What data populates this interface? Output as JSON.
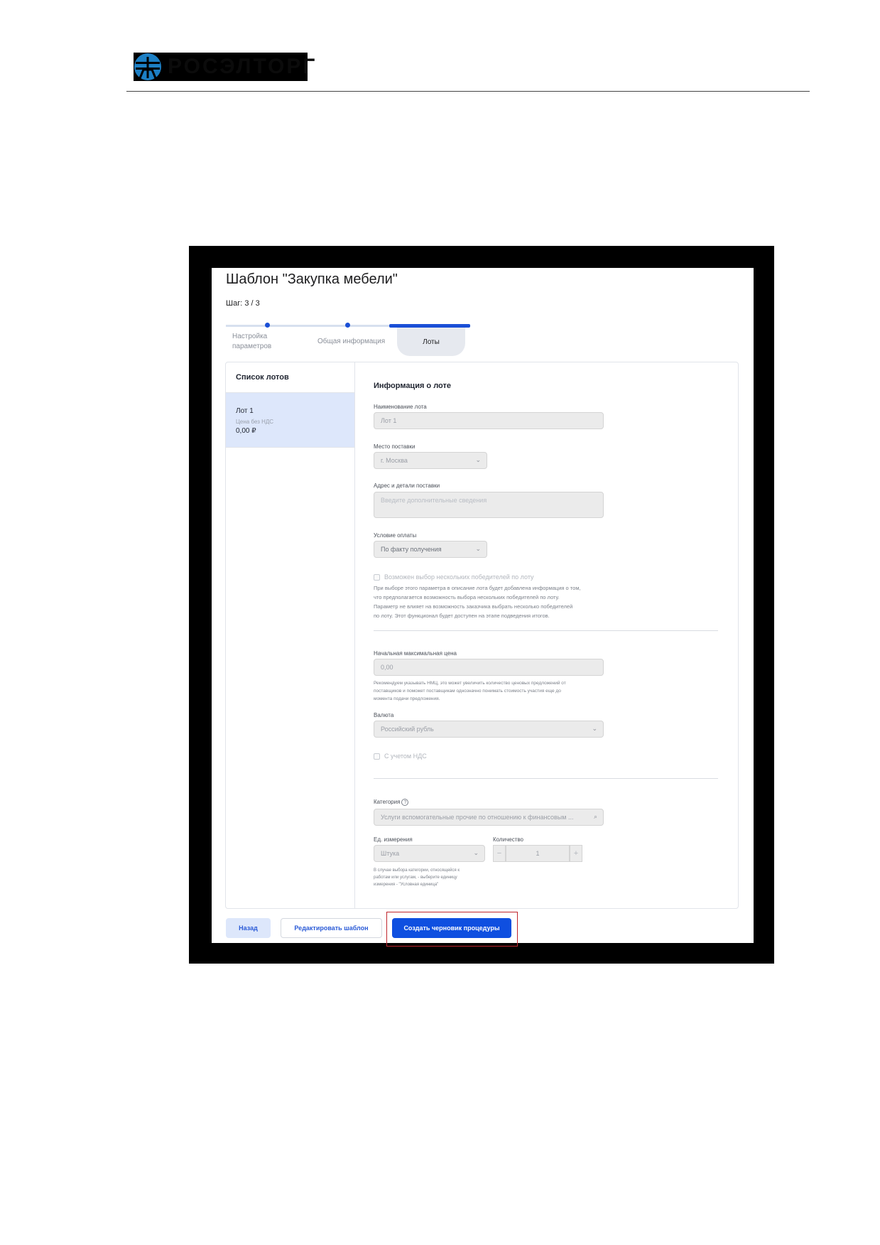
{
  "document": {
    "logo_text": "РОСЭЛТОРГ"
  },
  "page": {
    "title": "Шаблон \"Закупка мебели\"",
    "step": "Шаг: 3 / 3"
  },
  "stepper": {
    "steps": [
      {
        "line1": "Настройка",
        "line2": "параметров"
      },
      {
        "line1": "Общая информация"
      },
      {
        "line1": "Лоты"
      }
    ]
  },
  "lots": {
    "title": "Список лотов",
    "items": [
      {
        "name": "Лот 1",
        "price_label": "Цена без НДС",
        "price": "0,00 ₽"
      }
    ]
  },
  "form": {
    "section_title": "Информация о лоте",
    "lot_name_label": "Наименование лота",
    "lot_name_value": "Лот 1",
    "delivery_place_label": "Место поставки",
    "delivery_place_value": "г. Москва",
    "address_label": "Адрес и детали поставки",
    "address_placeholder": "Введите дополнительные сведения",
    "payment_label": "Условие оплаты",
    "payment_value": "По факту получения",
    "multi_winners_label": "Возможен выбор нескольких победителей по лоту",
    "multi_winners_note": [
      "При выборе этого параметра в описание лота будет добавлена информация о том,",
      "что предполагается возможность выбора нескольких победителей по лоту.",
      "Параметр не влияет на возможность заказчика выбрать несколько победителей",
      "по лоту. Этот функционал будет доступен на этапе подведения итогов."
    ],
    "nmc_label": "Начальная максимальная цена",
    "nmc_value": "0,00",
    "nmc_note": [
      "Рекомендуем указывать НМЦ, это может увеличить количество ценовых предложений от",
      "поставщиков и поможет поставщикам однозначно понимать стоимость участия еще до",
      "момента подачи предложения."
    ],
    "currency_label": "Валюта",
    "currency_value": "Российский рубль",
    "vat_label": "С учетом НДС",
    "category_label": "Категория",
    "category_help": "?",
    "category_value": "Услуги вспомогательные прочие по отношению к финансовым ...",
    "unit_label": "Ед. измерения",
    "unit_value": "Штука",
    "quantity_label": "Количество",
    "quantity_value": "1",
    "quantity_minus": "−",
    "quantity_plus": "+",
    "unit_note": [
      "В случае выбора категории, относящейся к",
      "работам или услугам, - выберите единицу",
      "измерения - \"Условная единица\""
    ]
  },
  "buttons": {
    "back": "Назад",
    "edit": "Редактировать шаблон",
    "create": "Создать черновик процедуры"
  },
  "colors": {
    "accent": "#0f4fe0",
    "highlight": "#c0262d",
    "selected_lot": "#dde7fb"
  }
}
